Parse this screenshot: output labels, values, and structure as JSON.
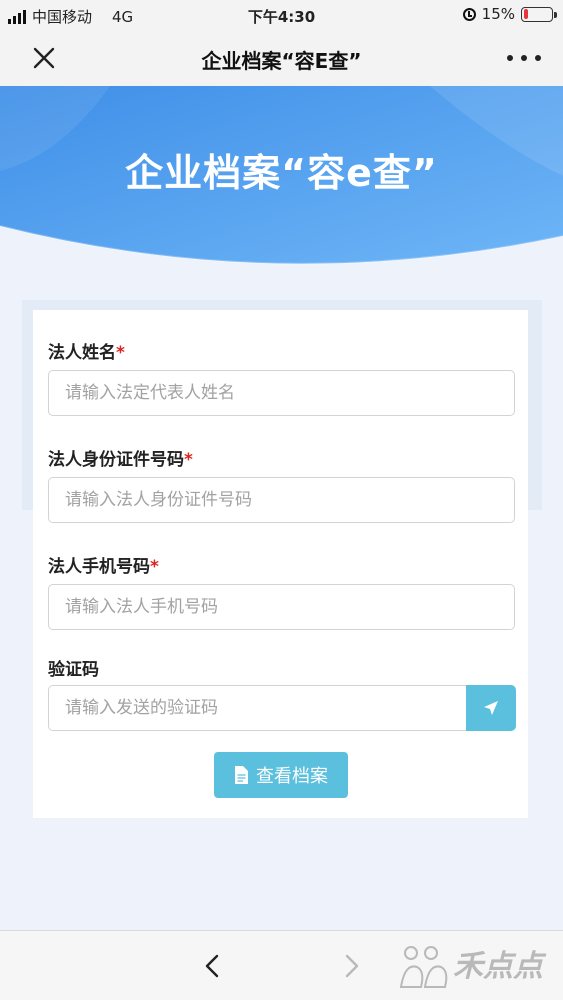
{
  "status_bar": {
    "carrier": "中国移动",
    "network": "4G",
    "time": "下午4:30",
    "battery": "15%"
  },
  "nav": {
    "title": "企业档案“容E查”",
    "close_icon": "close-icon",
    "more_icon": "more-icon"
  },
  "banner": {
    "title": "企业档案“容e查”"
  },
  "form": {
    "name_label": "法人姓名",
    "name_placeholder": "请输入法定代表人姓名",
    "id_label": "法人身份证件号码",
    "id_placeholder": "请输入法人身份证件号码",
    "phone_label": "法人手机号码",
    "phone_placeholder": "请输入法人手机号码",
    "code_label": "验证码",
    "code_placeholder": "请输入发送的验证码",
    "required_mark": "*",
    "submit_label": "查看档案",
    "send_icon": "send-icon",
    "document_icon": "document-icon"
  },
  "bottom_bar": {
    "back_icon": "chevron-left-icon",
    "forward_icon": "chevron-right-icon",
    "watermark": "禾点点"
  },
  "colors": {
    "banner_blue": "#4a9cf0",
    "button_cyan": "#5bc0de",
    "required_red": "#dd2222",
    "battery_red": "#e8353b"
  }
}
